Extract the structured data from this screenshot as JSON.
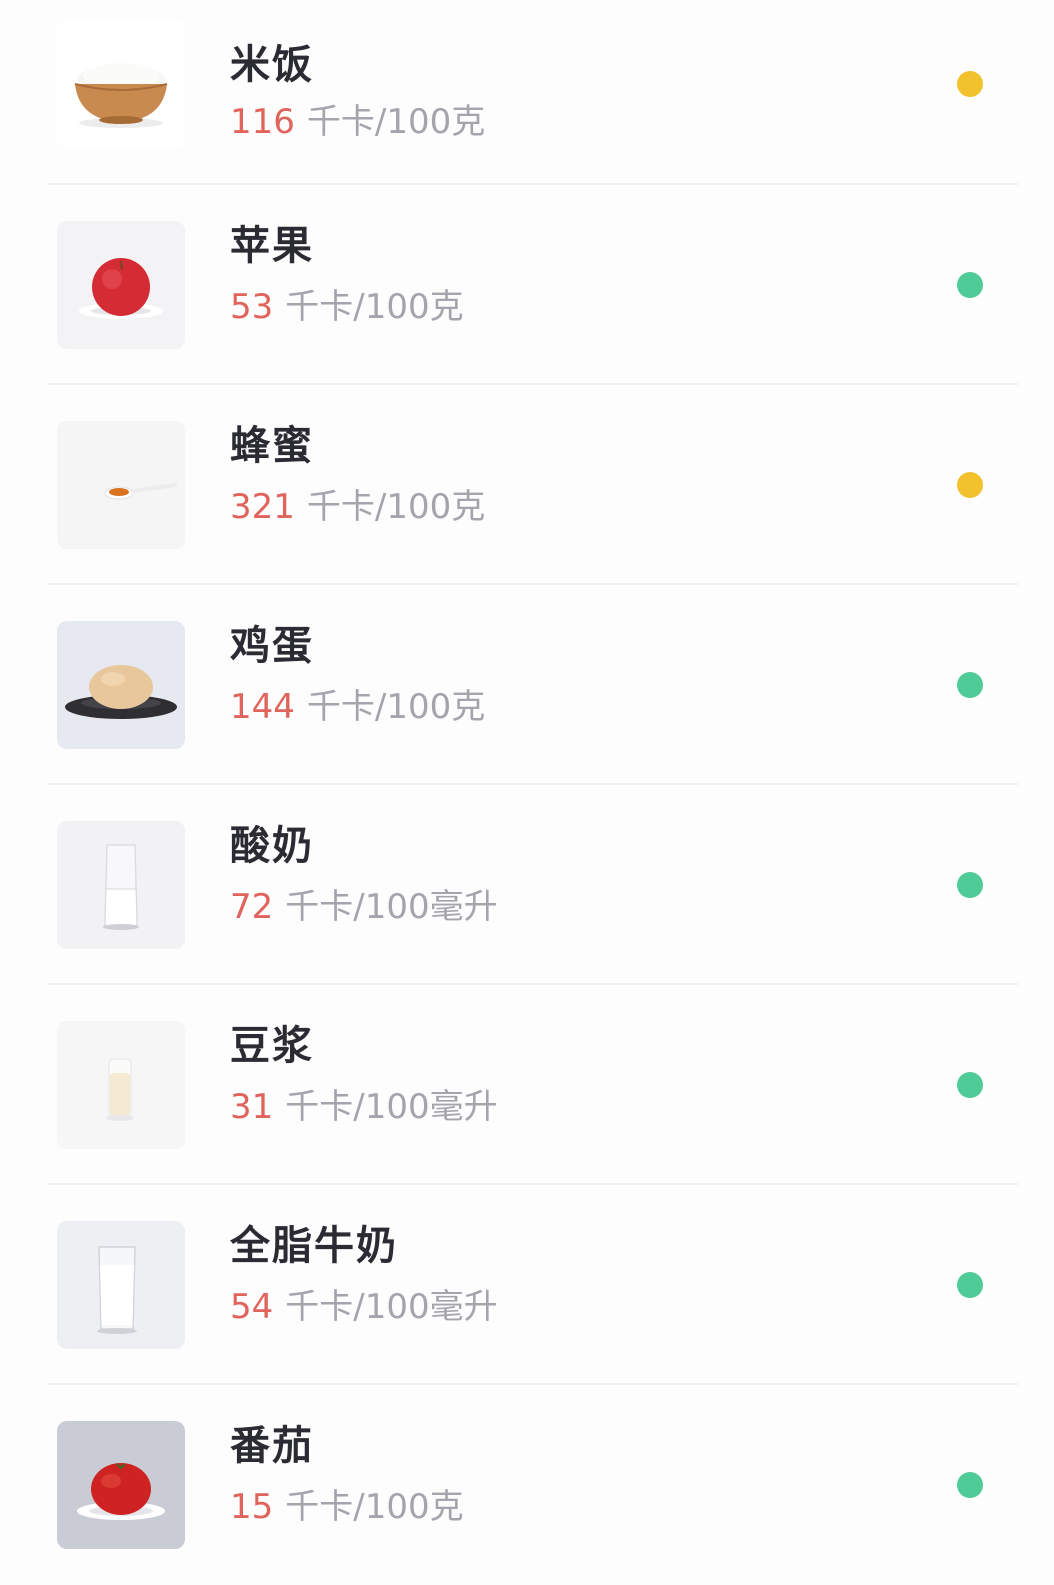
{
  "colors": {
    "calorie_number": "#e0645c",
    "dot_yellow": "#f2c12e",
    "dot_green": "#4ecb97"
  },
  "foods": [
    {
      "name": "米饭",
      "calories": "116",
      "unit": "千卡/100克",
      "indicator": "yellow",
      "icon": "rice-bowl-icon"
    },
    {
      "name": "苹果",
      "calories": "53",
      "unit": "千卡/100克",
      "indicator": "green",
      "icon": "apple-icon"
    },
    {
      "name": "蜂蜜",
      "calories": "321",
      "unit": "千卡/100克",
      "indicator": "yellow",
      "icon": "honey-spoon-icon"
    },
    {
      "name": "鸡蛋",
      "calories": "144",
      "unit": "千卡/100克",
      "indicator": "green",
      "icon": "egg-icon"
    },
    {
      "name": "酸奶",
      "calories": "72",
      "unit": "千卡/100毫升",
      "indicator": "green",
      "icon": "yogurt-glass-icon"
    },
    {
      "name": "豆浆",
      "calories": "31",
      "unit": "千卡/100毫升",
      "indicator": "green",
      "icon": "soy-milk-bottle-icon"
    },
    {
      "name": "全脂牛奶",
      "calories": "54",
      "unit": "千卡/100毫升",
      "indicator": "green",
      "icon": "milk-glass-icon"
    },
    {
      "name": "番茄",
      "calories": "15",
      "unit": "千卡/100克",
      "indicator": "green",
      "icon": "tomato-icon"
    }
  ]
}
